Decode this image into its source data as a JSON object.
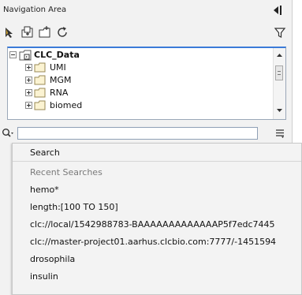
{
  "panel": {
    "title": "Navigation Area",
    "toolbar": {
      "icons": [
        "select-pointer-icon",
        "add-folder-icon",
        "new-folder-icon",
        "refresh-icon",
        "filter-funnel-icon"
      ]
    }
  },
  "tree": {
    "root": {
      "label": "CLC_Data",
      "expanded": true
    },
    "children": [
      {
        "label": "UMI"
      },
      {
        "label": "MGM"
      },
      {
        "label": "RNA"
      },
      {
        "label": "biomed"
      }
    ]
  },
  "search": {
    "value": "",
    "placeholder": "",
    "icon": "search-magnifier-icon"
  },
  "dropdown": {
    "search_label": "Search",
    "recent_header": "Recent Searches",
    "recent_items": [
      "hemo*",
      "length:[100 TO 150]",
      "clc://local/1542988783-BAAAAAAAAAAAAAP5f7edc7445",
      "clc://master-project01.aarhus.clcbio.com:7777/-1451594",
      "drosophila",
      "insulin"
    ]
  },
  "colors": {
    "panel_bg": "#f2f2f2",
    "selection_border": "#3b7bd8",
    "folder": "#e7c968",
    "muted_text": "#7a7a7a"
  }
}
